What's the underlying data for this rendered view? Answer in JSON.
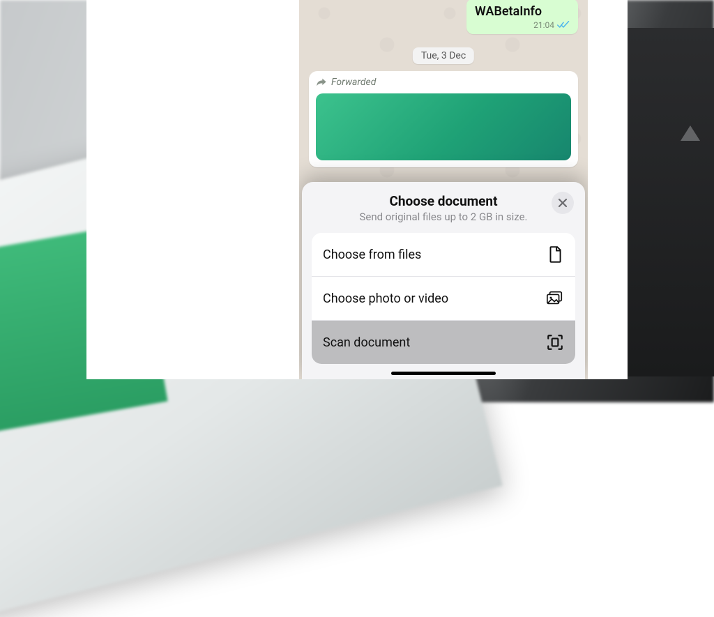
{
  "chat": {
    "outgoing_message": "WABetaInfo",
    "outgoing_time": "21:04",
    "date_separator": "Tue, 3 Dec",
    "forwarded_label": "Forwarded"
  },
  "sheet": {
    "title": "Choose document",
    "subtitle": "Send original files up to 2 GB in size.",
    "options": {
      "files": "Choose from files",
      "photo": "Choose photo or video",
      "scan": "Scan document"
    }
  }
}
